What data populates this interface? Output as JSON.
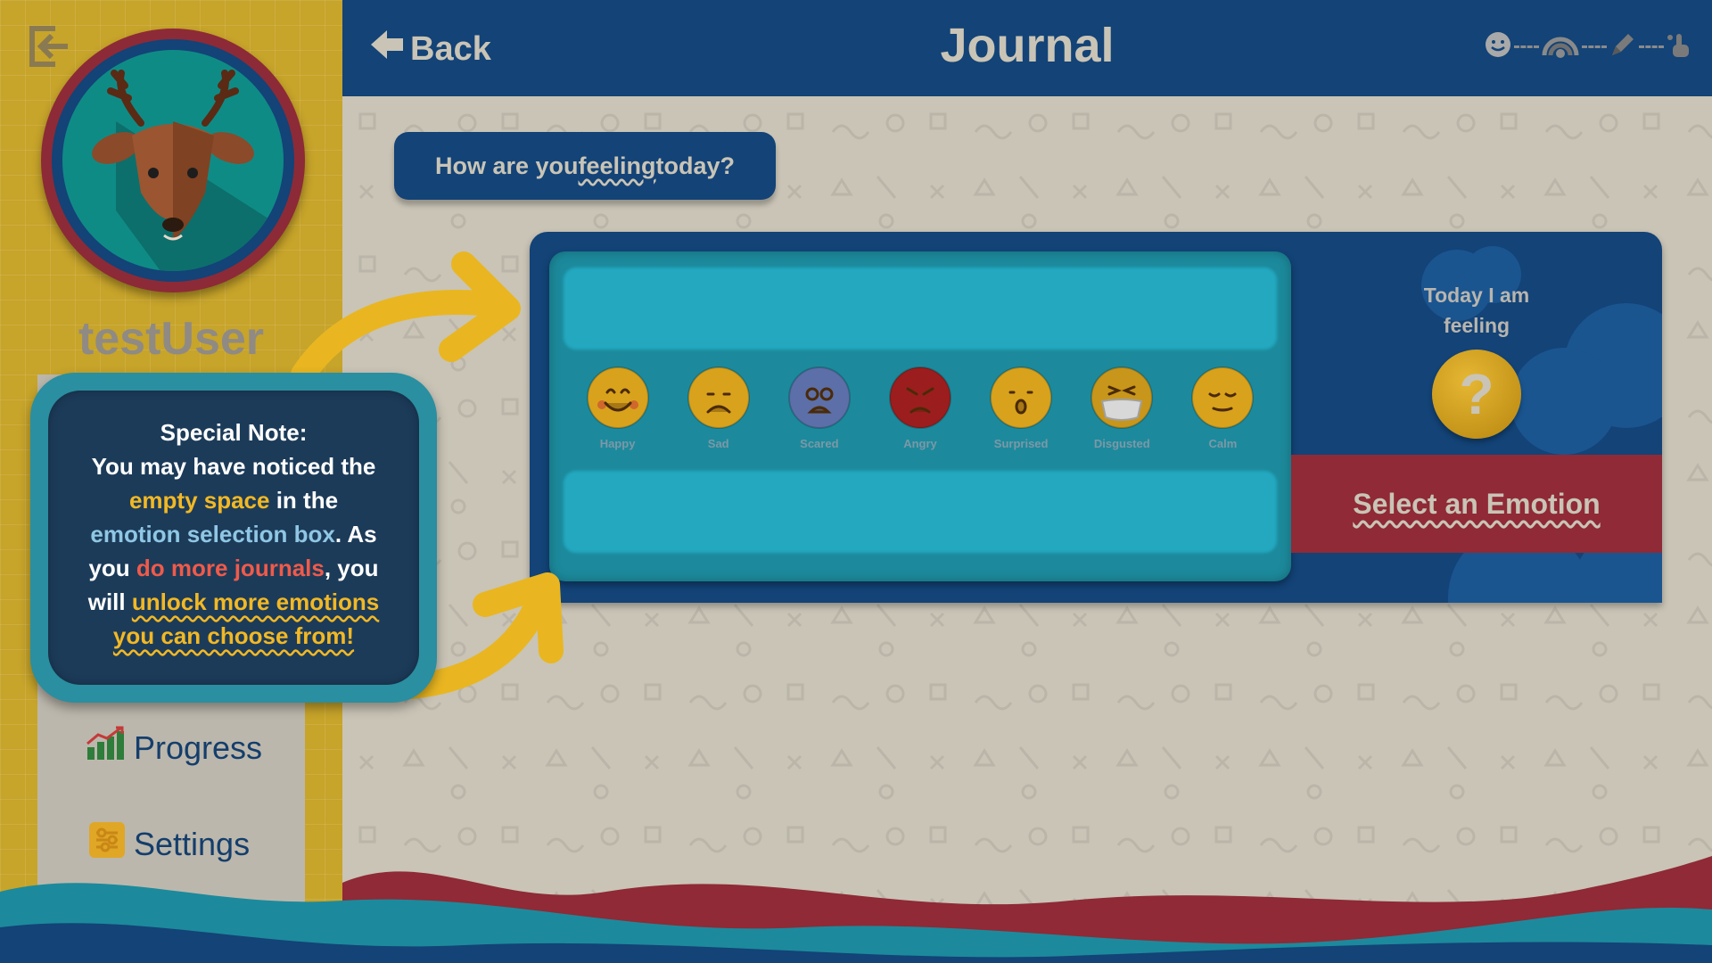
{
  "sidebar": {
    "username": "testUser",
    "nav": [
      {
        "label": "Progress",
        "icon": "chart-growth-icon"
      },
      {
        "label": "Settings",
        "icon": "sliders-icon"
      }
    ]
  },
  "header": {
    "back_label": "Back",
    "title": "Journal",
    "steps": [
      "smiley-step-icon",
      "rainbow-step-icon",
      "pencil-step-icon",
      "touch-step-icon"
    ]
  },
  "main": {
    "question": {
      "prefix": "How are you ",
      "emphasis": "feeling",
      "suffix": " today?"
    },
    "emotions": [
      {
        "label": "Happy",
        "icon": "happy-emoji-icon"
      },
      {
        "label": "Sad",
        "icon": "sad-emoji-icon"
      },
      {
        "label": "Scared",
        "icon": "scared-emoji-icon"
      },
      {
        "label": "Angry",
        "icon": "angry-emoji-icon"
      },
      {
        "label": "Surprised",
        "icon": "surprised-emoji-icon"
      },
      {
        "label": "Disgusted",
        "icon": "disgusted-emoji-icon"
      },
      {
        "label": "Calm",
        "icon": "calm-emoji-icon"
      }
    ],
    "result": {
      "today_label_line1": "Today I am",
      "today_label_line2": "feeling",
      "placeholder": "?",
      "select_label": "Select an Emotion"
    }
  },
  "note": {
    "title": "Special Note:",
    "p1": "You may have noticed the",
    "p2": "empty space",
    "p3": " in the",
    "p4": "emotion selection box",
    "p5": ". As",
    "p6": "you ",
    "p7": "do more journals",
    "p8": ", you",
    "p9": "will ",
    "p10": "unlock more emotions",
    "p11": "you can choose from!"
  },
  "colors": {
    "navy": "#134377",
    "mustard": "#c7a42a",
    "crimson": "#8f2a36",
    "teal": "#1c8a9c",
    "cream": "#c9c4b6"
  }
}
